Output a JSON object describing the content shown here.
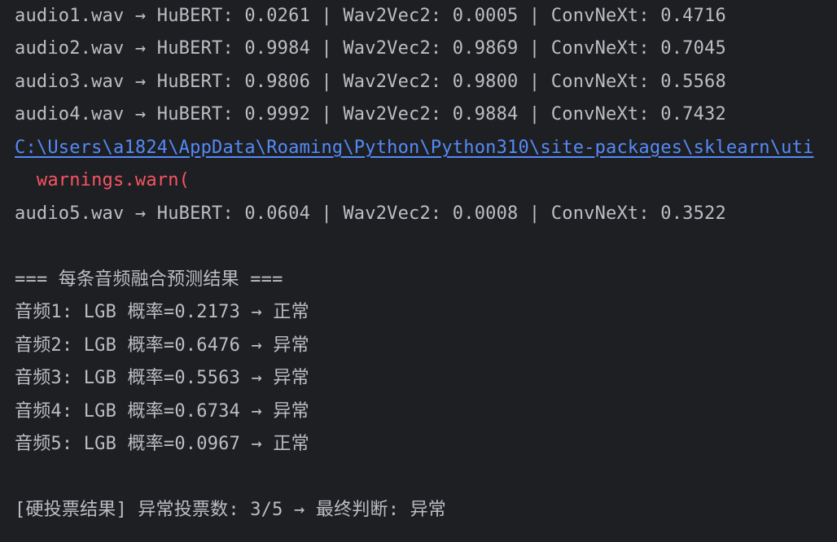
{
  "console": {
    "lines": [
      "audio1.wav → HuBERT: 0.0261 | Wav2Vec2: 0.0005 | ConvNeXt: 0.4716",
      "audio2.wav → HuBERT: 0.9984 | Wav2Vec2: 0.9869 | ConvNeXt: 0.7045",
      "audio3.wav → HuBERT: 0.9806 | Wav2Vec2: 0.9800 | ConvNeXt: 0.5568",
      "audio4.wav → HuBERT: 0.9992 | Wav2Vec2: 0.9884 | ConvNeXt: 0.7432",
      "C:\\Users\\a1824\\AppData\\Roaming\\Python\\Python310\\site-packages\\sklearn\\uti",
      "  warnings.warn(",
      "audio5.wav → HuBERT: 0.0604 | Wav2Vec2: 0.0008 | ConvNeXt: 0.3522",
      "=== 每条音频融合预测结果 ===",
      "音频1: LGB 概率=0.2173 → 正常",
      "音频2: LGB 概率=0.6476 → 异常",
      "音频3: LGB 概率=0.5563 → 异常",
      "音频4: LGB 概率=0.6734 → 异常",
      "音频5: LGB 概率=0.0967 → 正常",
      "[硬投票结果] 异常投票数: 3/5 → 最终判断: 异常"
    ]
  },
  "colors": {
    "background": "#1e1f22",
    "text": "#bcbec4",
    "link": "#548af7",
    "warning": "#f75464"
  }
}
